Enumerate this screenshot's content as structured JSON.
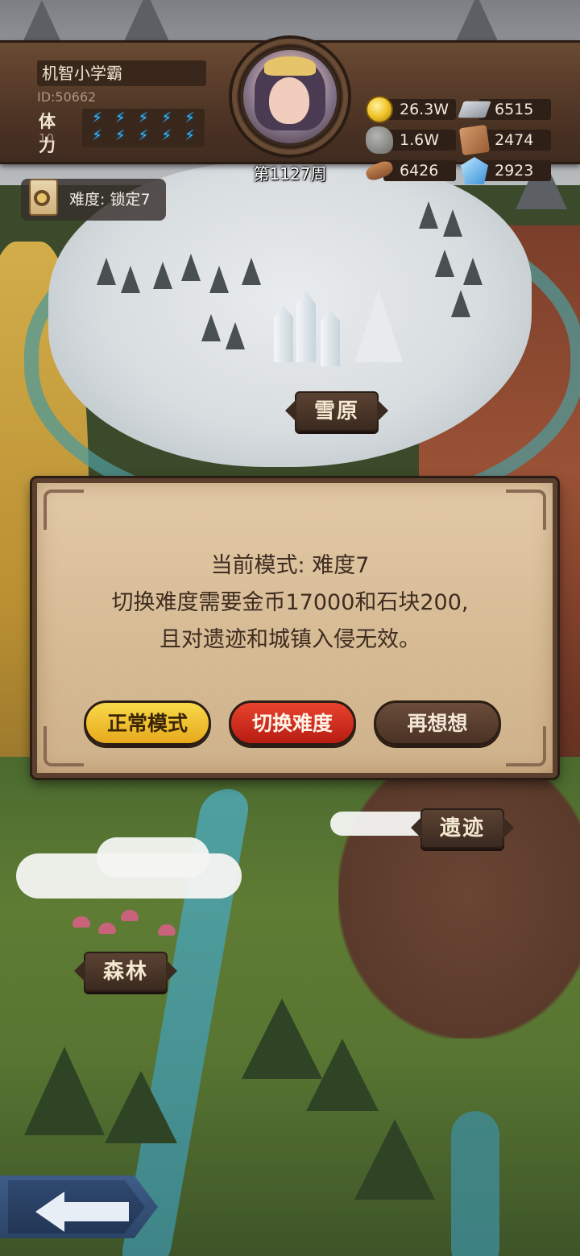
{
  "player": {
    "name": "机智小学霸",
    "id_text": "ID:50662",
    "stamina_label": "体力",
    "stamina_value": "10",
    "stamina_bolts": 10
  },
  "week_text": "第1127周",
  "resources": {
    "gold": {
      "icon": "gold-coin-icon",
      "value": "26.3W"
    },
    "iron": {
      "icon": "iron-ingot-icon",
      "value": "6515"
    },
    "stone": {
      "icon": "stone-icon",
      "value": "1.6W"
    },
    "leather": {
      "icon": "leather-icon",
      "value": "2474"
    },
    "wood": {
      "icon": "wood-log-icon",
      "value": "6426"
    },
    "crystal": {
      "icon": "crystal-icon",
      "value": "2923"
    }
  },
  "difficulty_chip": "难度: 锁定7",
  "locations": {
    "snowfield": "雪原",
    "ruins": "遗迹",
    "forest": "森林"
  },
  "dialog": {
    "line1": "当前模式: 难度7",
    "line2": "切换难度需要金币17000和石块200,",
    "line3": "且对遗迹和城镇入侵无效。",
    "btn_normal": "正常模式",
    "btn_switch": "切换难度",
    "btn_think": "再想想"
  },
  "colors": {
    "btn_normal": "#f2c232",
    "btn_switch": "#d2301f",
    "btn_think": "#5a3e2e",
    "stamina_bolt": "#36b8ff"
  }
}
